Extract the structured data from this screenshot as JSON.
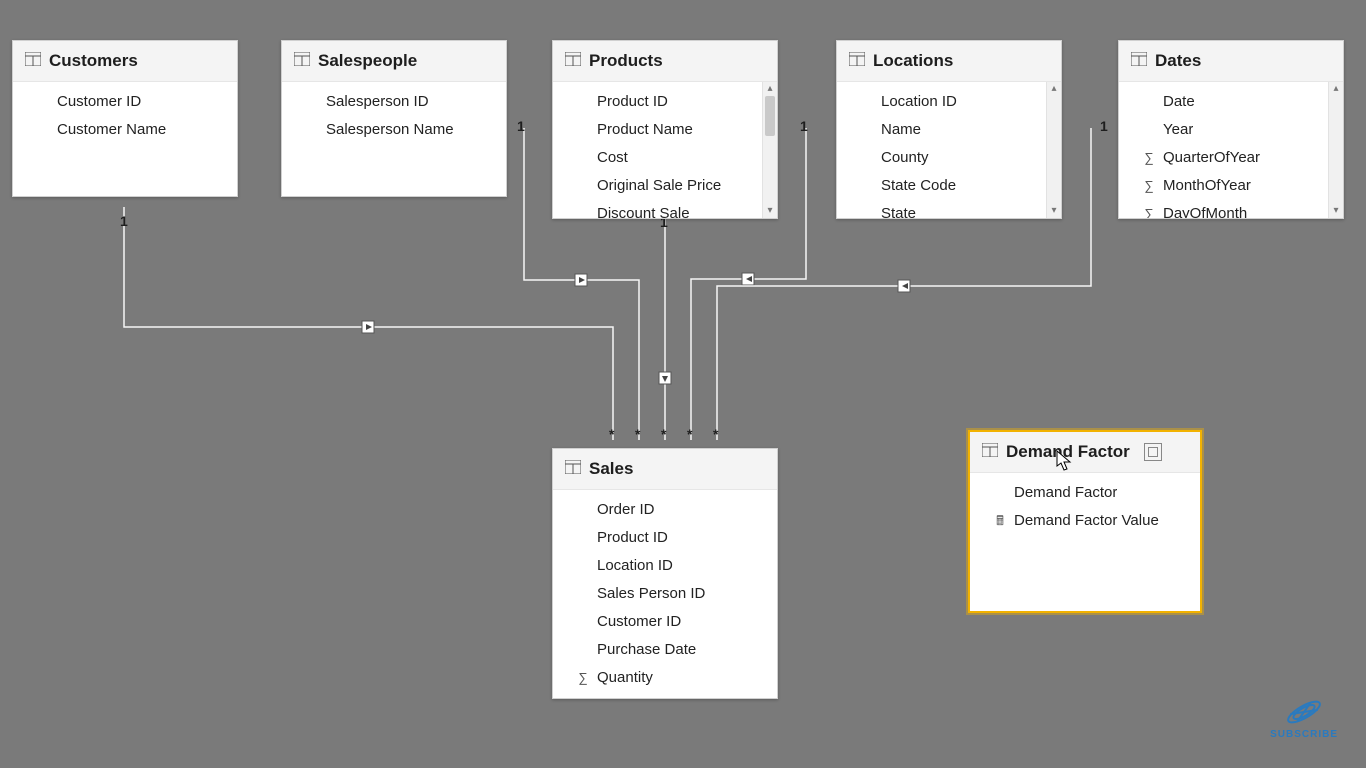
{
  "tables": {
    "customers": {
      "title": "Customers",
      "fields": [
        {
          "name": "Customer ID"
        },
        {
          "name": "Customer Name"
        }
      ]
    },
    "salespeople": {
      "title": "Salespeople",
      "fields": [
        {
          "name": "Salesperson ID"
        },
        {
          "name": "Salesperson Name"
        }
      ]
    },
    "products": {
      "title": "Products",
      "fields": [
        {
          "name": "Product ID"
        },
        {
          "name": "Product Name"
        },
        {
          "name": "Cost"
        },
        {
          "name": "Original Sale Price"
        },
        {
          "name": "Discount Sale"
        }
      ]
    },
    "locations": {
      "title": "Locations",
      "fields": [
        {
          "name": "Location ID"
        },
        {
          "name": "Name"
        },
        {
          "name": "County"
        },
        {
          "name": "State Code"
        },
        {
          "name": "State"
        }
      ]
    },
    "dates": {
      "title": "Dates",
      "fields": [
        {
          "name": "Date"
        },
        {
          "name": "Year"
        },
        {
          "name": "QuarterOfYear",
          "icon": "sigma"
        },
        {
          "name": "MonthOfYear",
          "icon": "sigma"
        },
        {
          "name": "DayOfMonth",
          "icon": "sigma"
        }
      ]
    },
    "sales": {
      "title": "Sales",
      "fields": [
        {
          "name": "Order ID"
        },
        {
          "name": "Product ID"
        },
        {
          "name": "Location ID"
        },
        {
          "name": "Sales Person ID"
        },
        {
          "name": "Customer ID"
        },
        {
          "name": "Purchase Date"
        },
        {
          "name": "Quantity",
          "icon": "sigma"
        }
      ]
    },
    "demand_factor": {
      "title": "Demand Factor",
      "fields": [
        {
          "name": "Demand Factor"
        },
        {
          "name": "Demand Factor Value",
          "icon": "calc"
        }
      ]
    }
  },
  "cardinality": {
    "one": "1",
    "many": "*"
  },
  "subscribe_label": "SUBSCRIBE"
}
